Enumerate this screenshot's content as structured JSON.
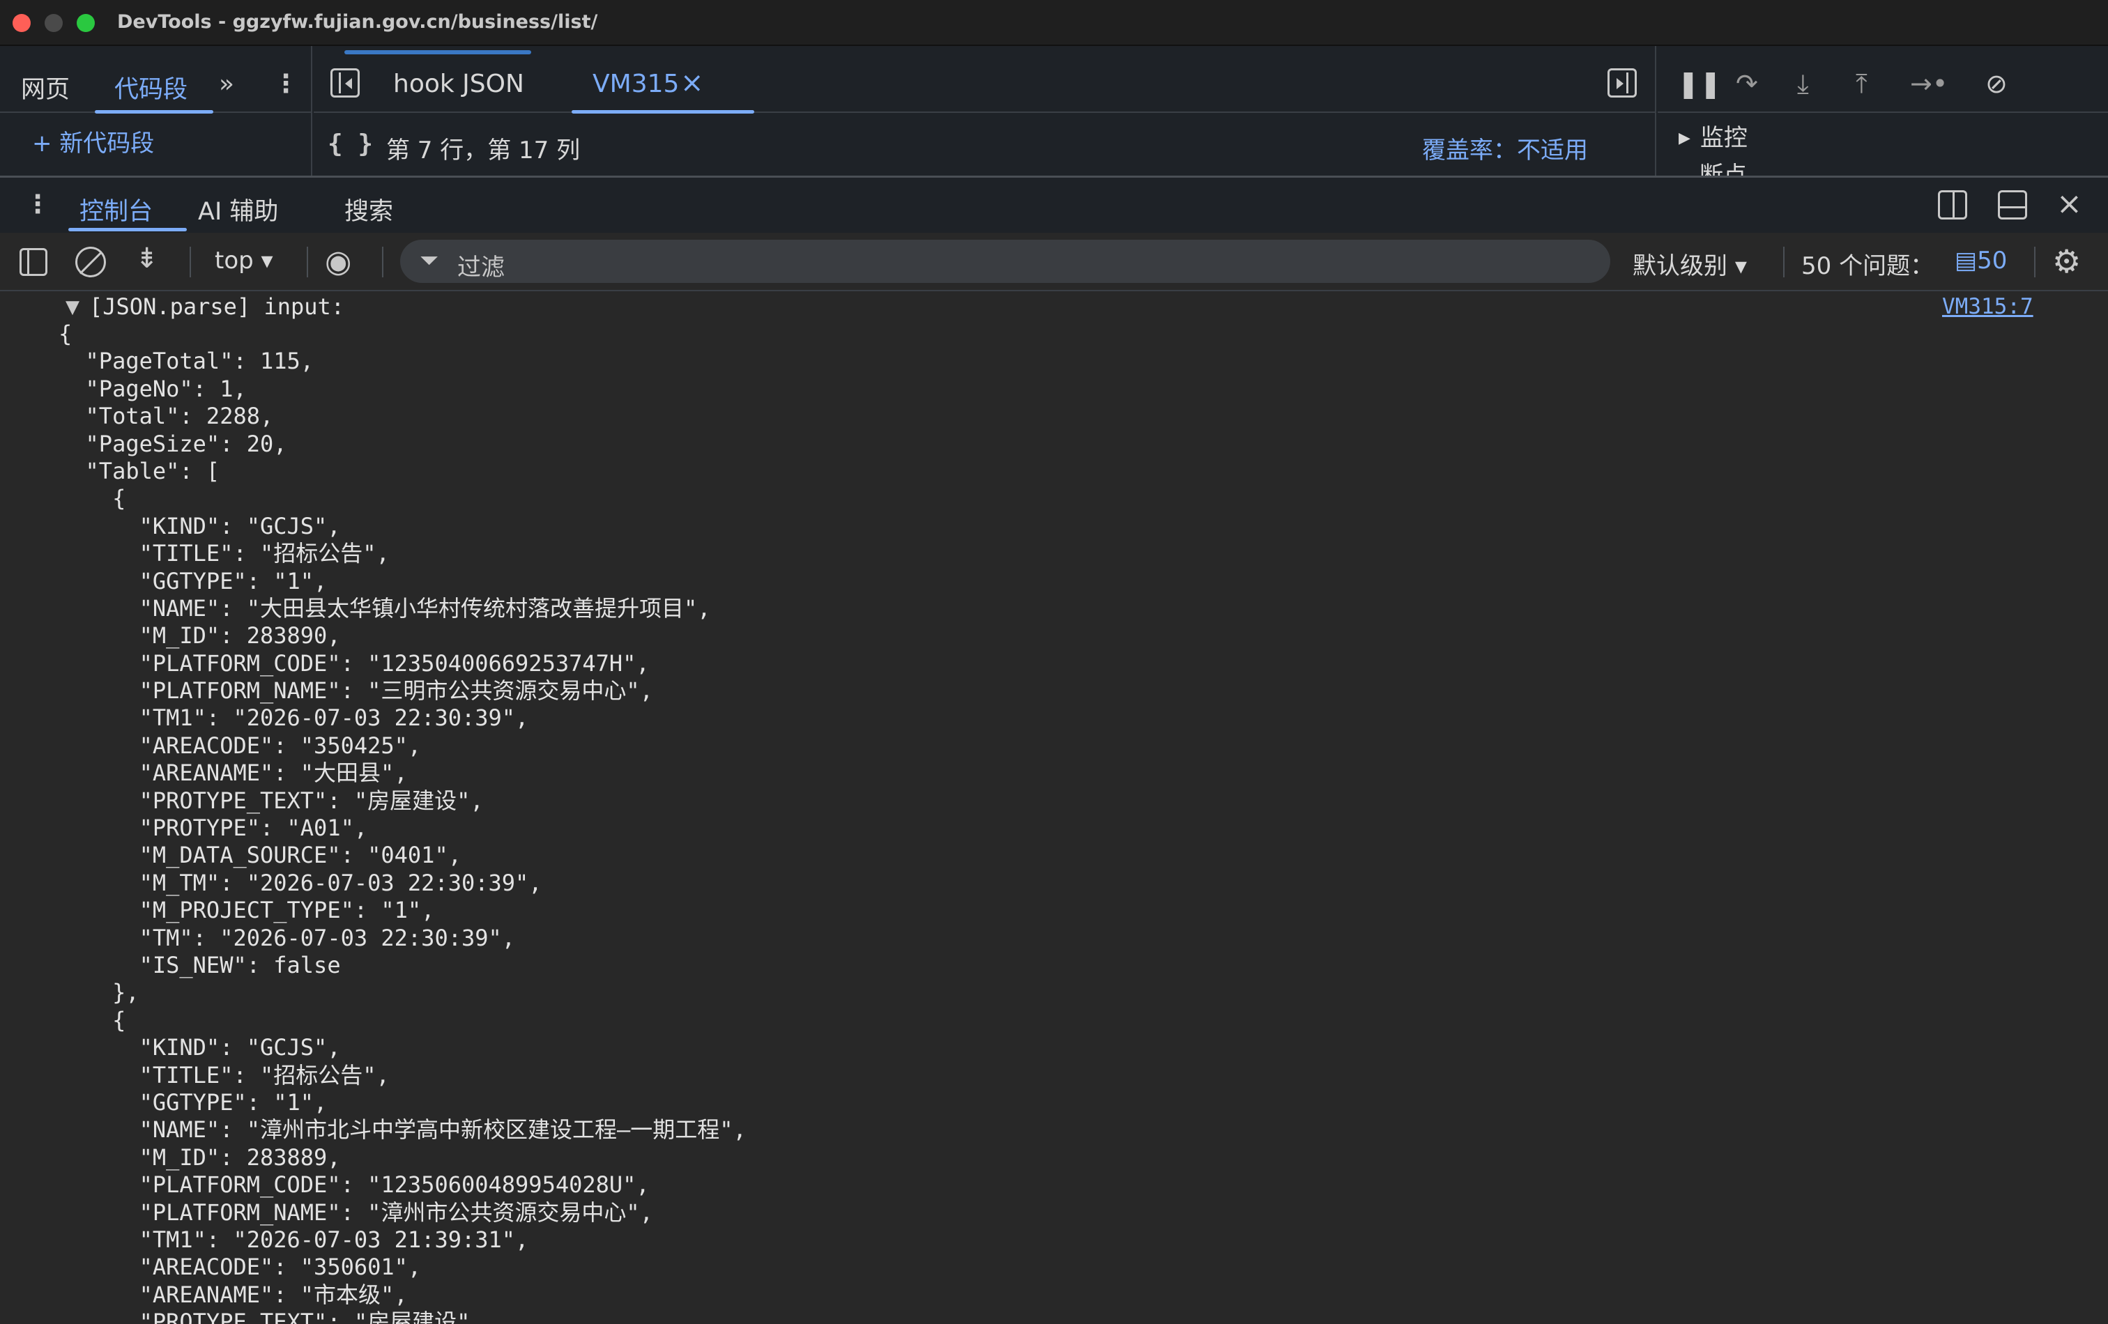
{
  "window": {
    "title": "DevTools - ggzyfw.fujian.gov.cn/business/list/"
  },
  "sources": {
    "nav_tabs": [
      "网页",
      "代码段"
    ],
    "new_snippet": "+ 新代码段",
    "editor_tabs": [
      "hook JSON",
      "VM315"
    ],
    "status": {
      "braces": "{ }",
      "cursor": "第 7 行，第 17 列",
      "coverage": "覆盖率：不适用"
    },
    "debugger": {
      "watch": "监控",
      "breakpoints": "断点"
    }
  },
  "drawer": {
    "tabs": [
      "控制台",
      "AI 辅助",
      "搜索"
    ]
  },
  "console_toolbar": {
    "context": "top",
    "filter_placeholder": "过滤",
    "levels": "默认级别",
    "issues_label": "50 个问题：",
    "issues_count": "50"
  },
  "console": {
    "log_label": "[JSON.parse] input:",
    "log_source": "VM315:7",
    "lines": [
      "{",
      "  \"PageTotal\": 115,",
      "  \"PageNo\": 1,",
      "  \"Total\": 2288,",
      "  \"PageSize\": 20,",
      "  \"Table\": [",
      "    {",
      "      \"KIND\": \"GCJS\",",
      "      \"TITLE\": \"招标公告\",",
      "      \"GGTYPE\": \"1\",",
      "      \"NAME\": \"大田县太华镇小华村传统村落改善提升项目\",",
      "      \"M_ID\": 283890,",
      "      \"PLATFORM_CODE\": \"12350400669253747H\",",
      "      \"PLATFORM_NAME\": \"三明市公共资源交易中心\",",
      "      \"TM1\": \"2026-07-03 22:30:39\",",
      "      \"AREACODE\": \"350425\",",
      "      \"AREANAME\": \"大田县\",",
      "      \"PROTYPE_TEXT\": \"房屋建设\",",
      "      \"PROTYPE\": \"A01\",",
      "      \"M_DATA_SOURCE\": \"0401\",",
      "      \"M_TM\": \"2026-07-03 22:30:39\",",
      "      \"M_PROJECT_TYPE\": \"1\",",
      "      \"TM\": \"2026-07-03 22:30:39\",",
      "      \"IS_NEW\": false",
      "    },",
      "    {",
      "      \"KIND\": \"GCJS\",",
      "      \"TITLE\": \"招标公告\",",
      "      \"GGTYPE\": \"1\",",
      "      \"NAME\": \"漳州市北斗中学高中新校区建设工程—一期工程\",",
      "      \"M_ID\": 283889,",
      "      \"PLATFORM_CODE\": \"12350600489954028U\",",
      "      \"PLATFORM_NAME\": \"漳州市公共资源交易中心\",",
      "      \"TM1\": \"2026-07-03 21:39:31\",",
      "      \"AREACODE\": \"350601\",",
      "      \"AREANAME\": \"市本级\",",
      "      \"PROTYPE_TEXT\": \"房屋建设\","
    ]
  }
}
